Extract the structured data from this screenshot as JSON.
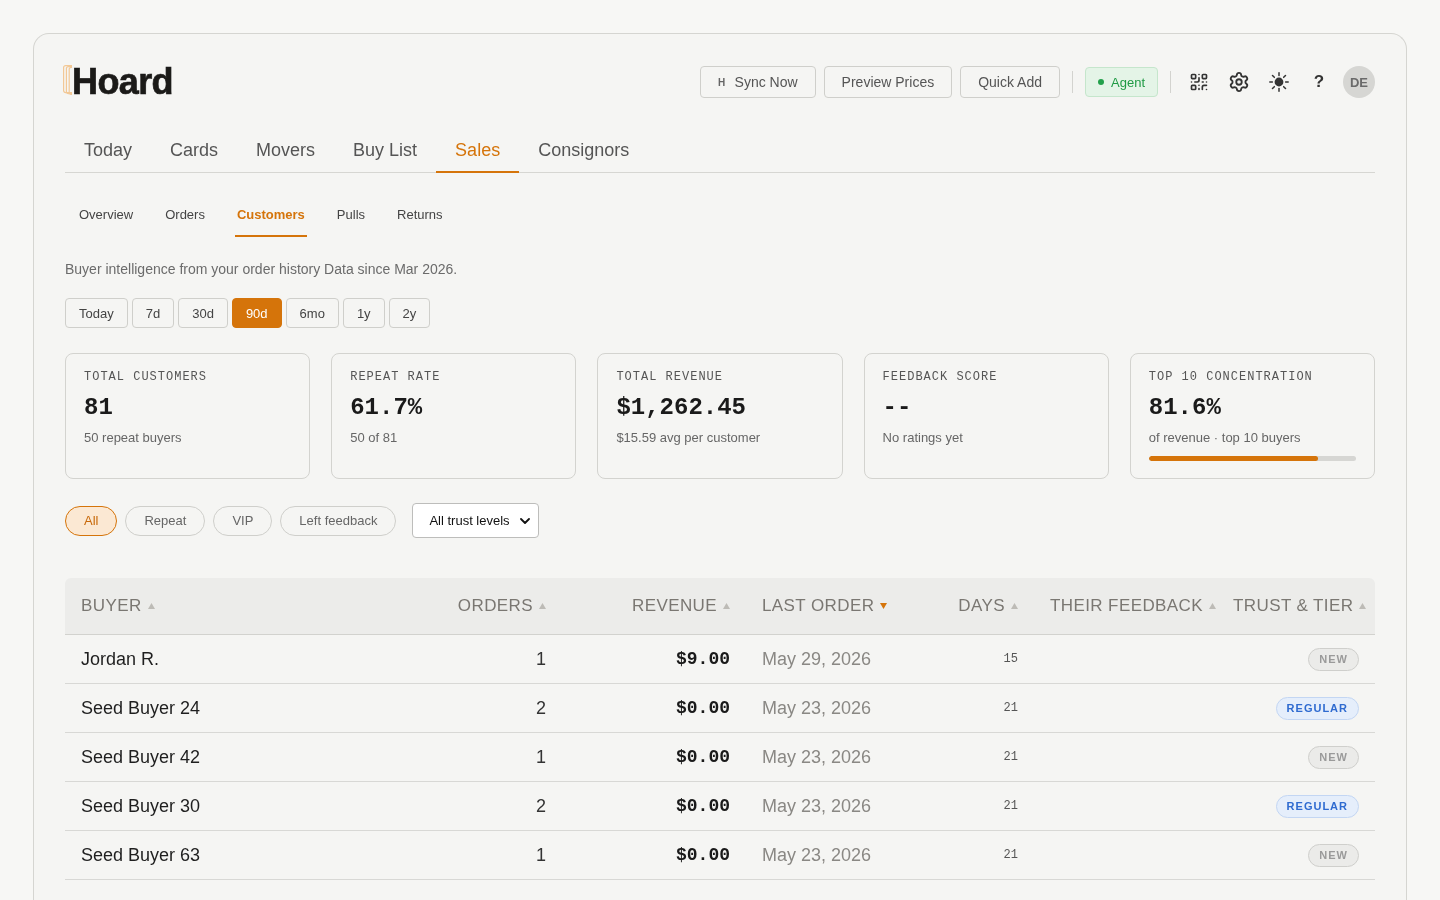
{
  "app": {
    "logo": "Hoard"
  },
  "header_actions": [
    {
      "label": "Sync Now",
      "shortcut": "H"
    },
    {
      "label": "Preview Prices"
    },
    {
      "label": "Quick Add"
    }
  ],
  "agent_badge": {
    "label": "Agent"
  },
  "help": "?",
  "avatar": "DE",
  "main_tabs": [
    {
      "label": "Today",
      "selected": false
    },
    {
      "label": "Cards",
      "selected": false
    },
    {
      "label": "Movers",
      "selected": false
    },
    {
      "label": "Buy List",
      "selected": false
    },
    {
      "label": "Sales",
      "selected": true
    },
    {
      "label": "Consignors",
      "selected": false
    }
  ],
  "sub_tabs": [
    {
      "label": "Overview",
      "selected": false
    },
    {
      "label": "Orders",
      "selected": false
    },
    {
      "label": "Customers",
      "selected": true
    },
    {
      "label": "Pulls",
      "selected": false
    },
    {
      "label": "Returns",
      "selected": false
    }
  ],
  "description": "Buyer intelligence from your order history Data since Mar 2026.",
  "ranges": [
    {
      "label": "Today",
      "selected": false
    },
    {
      "label": "7d",
      "selected": false
    },
    {
      "label": "30d",
      "selected": false
    },
    {
      "label": "90d",
      "selected": true
    },
    {
      "label": "6mo",
      "selected": false
    },
    {
      "label": "1y",
      "selected": false
    },
    {
      "label": "2y",
      "selected": false
    }
  ],
  "stats": [
    {
      "label": "TOTAL CUSTOMERS",
      "value": "81",
      "note": "50 repeat buyers"
    },
    {
      "label": "REPEAT RATE",
      "value": "61.7%",
      "note": "50 of 81"
    },
    {
      "label": "TOTAL REVENUE",
      "value": "$1,262.45",
      "note": "$15.59 avg per customer"
    },
    {
      "label": "FEEDBACK SCORE",
      "value": "--",
      "note": "No ratings yet"
    },
    {
      "label": "TOP 10 CONCENTRATION",
      "value": "81.6%",
      "note": "of revenue · top 10 buyers",
      "level": 0.816
    }
  ],
  "filters": [
    {
      "label": "All",
      "selected": true
    },
    {
      "label": "Repeat",
      "selected": false
    },
    {
      "label": "VIP",
      "selected": false
    },
    {
      "label": "Left feedback",
      "selected": false
    }
  ],
  "trust_filter": {
    "value": "All trust levels"
  },
  "table": {
    "columns": [
      {
        "label": "BUYER",
        "sorted": false
      },
      {
        "label": "ORDERS",
        "sorted": false
      },
      {
        "label": "REVENUE",
        "sorted": false
      },
      {
        "label": "LAST ORDER",
        "sorted": true
      },
      {
        "label": "DAYS",
        "sorted": false
      },
      {
        "label": "THEIR FEEDBACK",
        "sorted": false
      },
      {
        "label": "TRUST & TIER",
        "sorted": false
      }
    ],
    "rows": [
      {
        "buyer": "Jordan R.",
        "orders": "1",
        "revenue": "$9.00",
        "last_order": "May 29, 2026",
        "days": "15",
        "tier": {
          "label": "NEW",
          "kind": "new"
        }
      },
      {
        "buyer": "Seed Buyer 24",
        "orders": "2",
        "revenue": "$0.00",
        "last_order": "May 23, 2026",
        "days": "21",
        "tier": {
          "label": "REGULAR",
          "kind": "regular"
        }
      },
      {
        "buyer": "Seed Buyer 42",
        "orders": "1",
        "revenue": "$0.00",
        "last_order": "May 23, 2026",
        "days": "21",
        "tier": {
          "label": "NEW",
          "kind": "new"
        }
      },
      {
        "buyer": "Seed Buyer 30",
        "orders": "2",
        "revenue": "$0.00",
        "last_order": "May 23, 2026",
        "days": "21",
        "tier": {
          "label": "REGULAR",
          "kind": "regular"
        }
      },
      {
        "buyer": "Seed Buyer 63",
        "orders": "1",
        "revenue": "$0.00",
        "last_order": "May 23, 2026",
        "days": "21",
        "tier": {
          "label": "NEW",
          "kind": "new"
        }
      }
    ]
  }
}
